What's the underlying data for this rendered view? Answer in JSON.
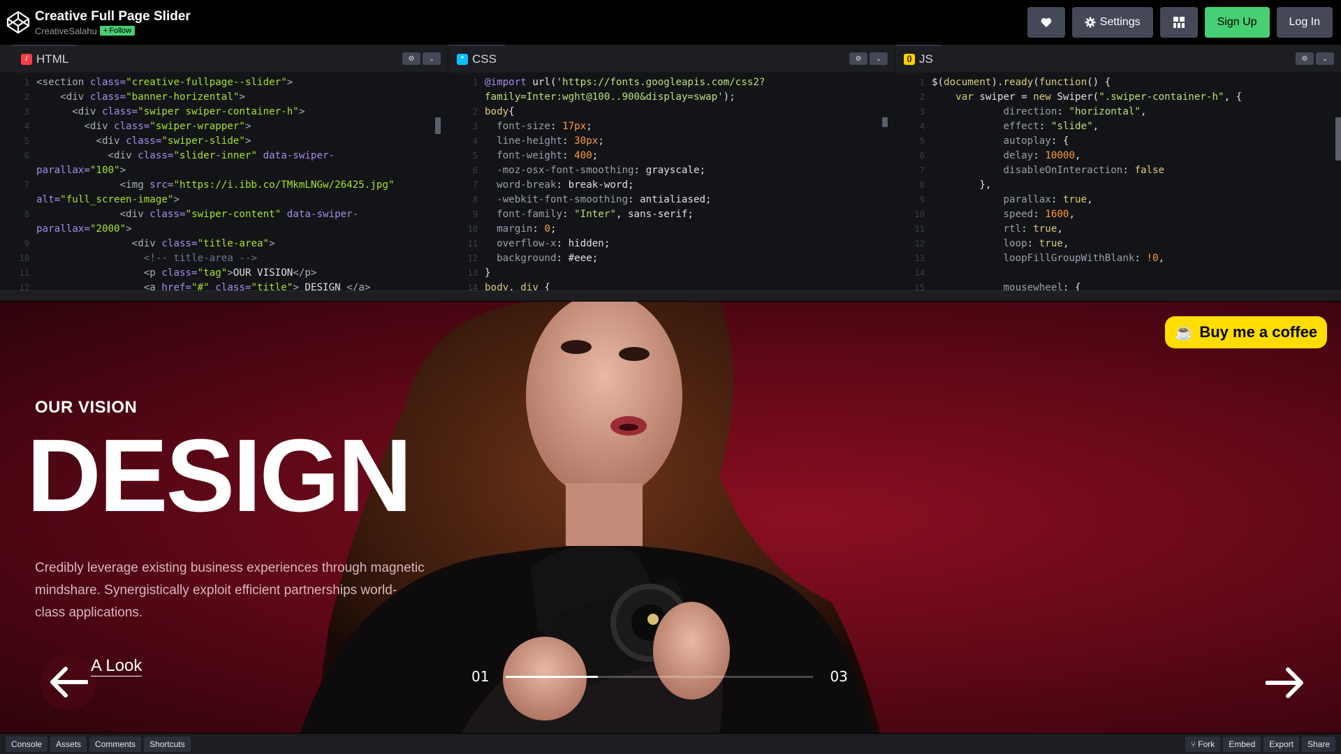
{
  "header": {
    "title": "Creative Full Page Slider",
    "author": "CreativeSalahu",
    "follow_label": "Follow",
    "settings_label": "Settings",
    "signup_label": "Sign Up",
    "login_label": "Log In"
  },
  "editors": {
    "html": {
      "label": "HTML",
      "lines": [
        {
          "n": "1",
          "parts": [
            [
              "tg",
              "<section "
            ],
            [
              "at",
              "class="
            ],
            [
              "st",
              "\"creative-fullpage--slider\""
            ],
            [
              "tg",
              ">"
            ]
          ]
        },
        {
          "n": "2",
          "parts": [
            [
              "tg",
              "    <div "
            ],
            [
              "at",
              "class="
            ],
            [
              "st",
              "\"banner-horizental\""
            ],
            [
              "tg",
              ">"
            ]
          ]
        },
        {
          "n": "3",
          "parts": [
            [
              "tg",
              "      <div "
            ],
            [
              "at",
              "class="
            ],
            [
              "st",
              "\"swiper swiper-container-h\""
            ],
            [
              "tg",
              ">"
            ]
          ]
        },
        {
          "n": "4",
          "parts": [
            [
              "tg",
              "        <div "
            ],
            [
              "at",
              "class="
            ],
            [
              "st",
              "\"swiper-wrapper\""
            ],
            [
              "tg",
              ">"
            ]
          ]
        },
        {
          "n": "5",
          "parts": [
            [
              "tg",
              "          <div "
            ],
            [
              "at",
              "class="
            ],
            [
              "st",
              "\"swiper-slide\""
            ],
            [
              "tg",
              ">"
            ]
          ]
        },
        {
          "n": "6",
          "parts": [
            [
              "tg",
              "            <div "
            ],
            [
              "at",
              "class="
            ],
            [
              "st",
              "\"slider-inner\""
            ],
            [
              "at",
              " data-swiper-"
            ]
          ]
        },
        {
          "n": "",
          "parts": [
            [
              "at",
              "parallax="
            ],
            [
              "st",
              "\"100\""
            ],
            [
              "tg",
              ">"
            ]
          ]
        },
        {
          "n": "7",
          "parts": [
            [
              "tg",
              "              <img "
            ],
            [
              "at",
              "src="
            ],
            [
              "st",
              "\"https://i.ibb.co/TMkmLNGw/26425.jpg\""
            ]
          ]
        },
        {
          "n": "",
          "parts": [
            [
              "at",
              "alt="
            ],
            [
              "st",
              "\"full_screen-image\""
            ],
            [
              "tg",
              ">"
            ]
          ]
        },
        {
          "n": "8",
          "parts": [
            [
              "tg",
              "              <div "
            ],
            [
              "at",
              "class="
            ],
            [
              "st",
              "\"swiper-content\""
            ],
            [
              "at",
              " data-swiper-"
            ]
          ]
        },
        {
          "n": "",
          "parts": [
            [
              "at",
              "parallax="
            ],
            [
              "st",
              "\"2000\""
            ],
            [
              "tg",
              ">"
            ]
          ]
        },
        {
          "n": "9",
          "parts": [
            [
              "tg",
              "                <div "
            ],
            [
              "at",
              "class="
            ],
            [
              "st",
              "\"title-area\""
            ],
            [
              "tg",
              ">"
            ]
          ]
        },
        {
          "n": "10",
          "parts": [
            [
              "cm",
              "                  <!-- title-area -->"
            ]
          ]
        },
        {
          "n": "11",
          "parts": [
            [
              "tg",
              "                  <p "
            ],
            [
              "at",
              "class="
            ],
            [
              "st",
              "\"tag\""
            ],
            [
              "tg",
              ">"
            ],
            [
              "ct",
              "OUR VISION"
            ],
            [
              "tg",
              "</p>"
            ]
          ]
        },
        {
          "n": "12",
          "parts": [
            [
              "tg",
              "                  <a "
            ],
            [
              "at",
              "href="
            ],
            [
              "st",
              "\"#\""
            ],
            [
              "at",
              " class="
            ],
            [
              "st",
              "\"title\""
            ],
            [
              "tg",
              "> "
            ],
            [
              "ct",
              "DESIGN "
            ],
            [
              "tg",
              "</a>"
            ]
          ]
        }
      ]
    },
    "css": {
      "label": "CSS",
      "lines": [
        {
          "n": "1",
          "parts": [
            [
              "at",
              "@import "
            ],
            [
              "ct",
              "url("
            ],
            [
              "strv",
              "'https://fonts.googleapis.com/css2?"
            ]
          ]
        },
        {
          "n": "",
          "parts": [
            [
              "strv",
              "family=Inter:wght@100..900&display=swap'"
            ],
            [
              "ct",
              ");"
            ]
          ]
        },
        {
          "n": "2",
          "parts": [
            [
              "kw",
              "body"
            ],
            [
              "ct",
              "{"
            ]
          ]
        },
        {
          "n": "3",
          "parts": [
            [
              "pr",
              "  font-size"
            ],
            [
              "ct",
              ": "
            ],
            [
              "nm",
              "17px"
            ],
            [
              "ct",
              ";"
            ]
          ]
        },
        {
          "n": "4",
          "parts": [
            [
              "pr",
              "  line-height"
            ],
            [
              "ct",
              ": "
            ],
            [
              "nm",
              "30px"
            ],
            [
              "ct",
              ";"
            ]
          ]
        },
        {
          "n": "5",
          "parts": [
            [
              "pr",
              "  font-weight"
            ],
            [
              "ct",
              ": "
            ],
            [
              "nm",
              "400"
            ],
            [
              "ct",
              ";"
            ]
          ]
        },
        {
          "n": "6",
          "parts": [
            [
              "pr",
              "  -moz-osx-font-smoothing"
            ],
            [
              "ct",
              ": grayscale;"
            ]
          ]
        },
        {
          "n": "7",
          "parts": [
            [
              "pr",
              "  word-break"
            ],
            [
              "ct",
              ": break-word;"
            ]
          ]
        },
        {
          "n": "8",
          "parts": [
            [
              "pr",
              "  -webkit-font-smoothing"
            ],
            [
              "ct",
              ": antialiased;"
            ]
          ]
        },
        {
          "n": "9",
          "parts": [
            [
              "pr",
              "  font-family"
            ],
            [
              "ct",
              ": "
            ],
            [
              "strv",
              "\"Inter\""
            ],
            [
              "ct",
              ", sans-serif;"
            ]
          ]
        },
        {
          "n": "10",
          "parts": [
            [
              "pr",
              "  margin"
            ],
            [
              "ct",
              ": "
            ],
            [
              "nm",
              "0"
            ],
            [
              "ct",
              ";"
            ]
          ]
        },
        {
          "n": "11",
          "parts": [
            [
              "pr",
              "  overflow-x"
            ],
            [
              "ct",
              ": hidden;"
            ]
          ]
        },
        {
          "n": "12",
          "parts": [
            [
              "pr",
              "  background"
            ],
            [
              "ct",
              ": #eee;"
            ]
          ]
        },
        {
          "n": "13",
          "parts": [
            [
              "ct",
              "}"
            ]
          ]
        },
        {
          "n": "14",
          "parts": [
            [
              "kw",
              "body"
            ],
            [
              "ct",
              ", "
            ],
            [
              "kw",
              "div"
            ],
            [
              "ct",
              " {"
            ]
          ]
        }
      ]
    },
    "js": {
      "label": "JS",
      "lines": [
        {
          "n": "1",
          "parts": [
            [
              "ct",
              "$("
            ],
            [
              "kw",
              "document"
            ],
            [
              "ct",
              ")."
            ],
            [
              "fn",
              "ready"
            ],
            [
              "ct",
              "("
            ],
            [
              "kw",
              "function"
            ],
            [
              "ct",
              "() {"
            ]
          ]
        },
        {
          "n": "2",
          "parts": [
            [
              "kw",
              "    var "
            ],
            [
              "ct",
              "swiper = "
            ],
            [
              "kw",
              "new "
            ],
            [
              "ct",
              "Swiper("
            ],
            [
              "strv",
              "\".swiper-container-h\""
            ],
            [
              "ct",
              ", {"
            ]
          ]
        },
        {
          "n": "3",
          "parts": [
            [
              "pr",
              "            direction"
            ],
            [
              "ct",
              ": "
            ],
            [
              "strv",
              "\"horizontal\""
            ],
            [
              "ct",
              ","
            ]
          ]
        },
        {
          "n": "4",
          "parts": [
            [
              "pr",
              "            effect"
            ],
            [
              "ct",
              ": "
            ],
            [
              "strv",
              "\"slide\""
            ],
            [
              "ct",
              ","
            ]
          ]
        },
        {
          "n": "5",
          "parts": [
            [
              "pr",
              "            autoplay"
            ],
            [
              "ct",
              ": {"
            ]
          ]
        },
        {
          "n": "6",
          "parts": [
            [
              "pr",
              "            delay"
            ],
            [
              "ct",
              ": "
            ],
            [
              "nm",
              "10000"
            ],
            [
              "ct",
              ","
            ]
          ]
        },
        {
          "n": "7",
          "parts": [
            [
              "pr",
              "            disableOnInteraction"
            ],
            [
              "ct",
              ": "
            ],
            [
              "kw",
              "false"
            ]
          ]
        },
        {
          "n": "8",
          "parts": [
            [
              "ct",
              "        },"
            ]
          ]
        },
        {
          "n": "9",
          "parts": [
            [
              "pr",
              "            parallax"
            ],
            [
              "ct",
              ": "
            ],
            [
              "kw",
              "true"
            ],
            [
              "ct",
              ","
            ]
          ]
        },
        {
          "n": "10",
          "parts": [
            [
              "pr",
              "            speed"
            ],
            [
              "ct",
              ": "
            ],
            [
              "nm",
              "1600"
            ],
            [
              "ct",
              ","
            ]
          ]
        },
        {
          "n": "11",
          "parts": [
            [
              "pr",
              "            rtl"
            ],
            [
              "ct",
              ": "
            ],
            [
              "kw",
              "true"
            ],
            [
              "ct",
              ","
            ]
          ]
        },
        {
          "n": "12",
          "parts": [
            [
              "pr",
              "            loop"
            ],
            [
              "ct",
              ": "
            ],
            [
              "kw",
              "true"
            ],
            [
              "ct",
              ","
            ]
          ]
        },
        {
          "n": "13",
          "parts": [
            [
              "pr",
              "            loopFillGroupWithBlank"
            ],
            [
              "ct",
              ": "
            ],
            [
              "nm",
              "!0"
            ],
            [
              "ct",
              ","
            ]
          ]
        },
        {
          "n": "14",
          "parts": [
            [
              "ct",
              ""
            ]
          ]
        },
        {
          "n": "15",
          "parts": [
            [
              "pr",
              "            mousewheel"
            ],
            [
              "ct",
              ": {"
            ]
          ]
        }
      ]
    }
  },
  "preview": {
    "coffee_label": "Buy me a coffee",
    "tag": "OUR VISION",
    "title": "DESIGN",
    "description": "Credibly leverage existing business experiences through magnetic mindshare. Synergistically exploit efficient partnerships world-class applications.",
    "link_label": "A Look",
    "page_current": "01",
    "page_total": "03",
    "progress_fraction": 0.3
  },
  "bottombar": {
    "left": [
      "Console",
      "Assets",
      "Comments",
      "Shortcuts"
    ],
    "right": [
      "Fork",
      "Embed",
      "Export",
      "Share"
    ]
  },
  "colors": {
    "accent_green": "#47cf73",
    "coffee_yellow": "#ffdd00",
    "preview_red": "#8b0f22"
  }
}
